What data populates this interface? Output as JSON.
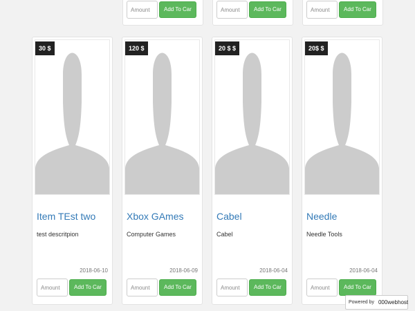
{
  "colors": {
    "link": "#337ab7",
    "button": "#5cb85c",
    "price_tag": "#222222",
    "placeholder_silhouette": "#cccccc"
  },
  "top_row": [
    {
      "amount_placeholder": "Amount",
      "button_label": "Add To Car"
    },
    {
      "amount_placeholder": "Amount",
      "button_label": "Add To Car"
    },
    {
      "amount_placeholder": "Amount",
      "button_label": "Add To Car"
    }
  ],
  "products": [
    {
      "price": "30 $",
      "title": "Item TEst two",
      "description": "test descritpion",
      "date": "2018-06-10",
      "amount_placeholder": "Amount",
      "button_label": "Add To Car",
      "image_icon": "person-silhouette-icon"
    },
    {
      "price": "120 $",
      "title": "Xbox GAmes",
      "description": "Computer Games",
      "date": "2018-06-09",
      "amount_placeholder": "Amount",
      "button_label": "Add To Car",
      "image_icon": "person-silhouette-icon"
    },
    {
      "price": "20 $ $",
      "title": "Cabel",
      "description": "Cabel",
      "date": "2018-06-04",
      "amount_placeholder": "Amount",
      "button_label": "Add To Car",
      "image_icon": "person-silhouette-icon"
    },
    {
      "price": "20$ $",
      "title": "Needle",
      "description": "Needle Tools",
      "date": "2018-06-04",
      "amount_placeholder": "Amount",
      "button_label": "Add To Car",
      "image_icon": "person-silhouette-icon"
    }
  ],
  "badge": {
    "prefix": "Powered by",
    "brand": "000webhost",
    "logo_icon": "000webhost-logo-icon"
  }
}
